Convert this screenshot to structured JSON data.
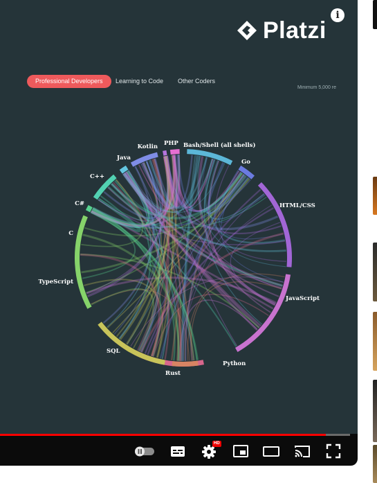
{
  "logo": {
    "brand": "Platzi",
    "icon": "platzi-logo-icon"
  },
  "tabs": [
    {
      "label": "Professional Developers",
      "active": true
    },
    {
      "label": "Learning to Code",
      "active": false
    },
    {
      "label": "Other Coders",
      "active": false
    }
  ],
  "note": "Minimum 5,000 re",
  "chord": {
    "languages": [
      {
        "label": "Bash/Shell (all shells)",
        "color": "#5cb7d8"
      },
      {
        "label": "Go",
        "color": "#6b7be0"
      },
      {
        "label": "HTML/CSS",
        "color": "#a266d6"
      },
      {
        "label": "JavaScript",
        "color": "#c873cf"
      },
      {
        "label": "Python",
        "color": "#d7668c"
      },
      {
        "label": "Rust",
        "color": "#d88463"
      },
      {
        "label": "SQL",
        "color": "#c8c45a"
      },
      {
        "label": "TypeScript",
        "color": "#86d36a"
      },
      {
        "label": "C",
        "color": "#57d28f"
      },
      {
        "label": "C#",
        "color": "#52d1b2"
      },
      {
        "label": "C++",
        "color": "#63c6e0"
      },
      {
        "label": "Java",
        "color": "#7f8de6"
      },
      {
        "label": "Kotlin",
        "color": "#b574de"
      },
      {
        "label": "PHP",
        "color": "#e56fd1"
      }
    ]
  },
  "player": {
    "progress_fraction": 0.93,
    "hd_badge": "HD",
    "accent": "#ff0000",
    "icons": [
      "autoplay-toggle-icon",
      "subtitles-icon",
      "settings-icon",
      "miniplayer-icon",
      "theater-mode-icon",
      "cast-icon",
      "fullscreen-icon"
    ]
  }
}
